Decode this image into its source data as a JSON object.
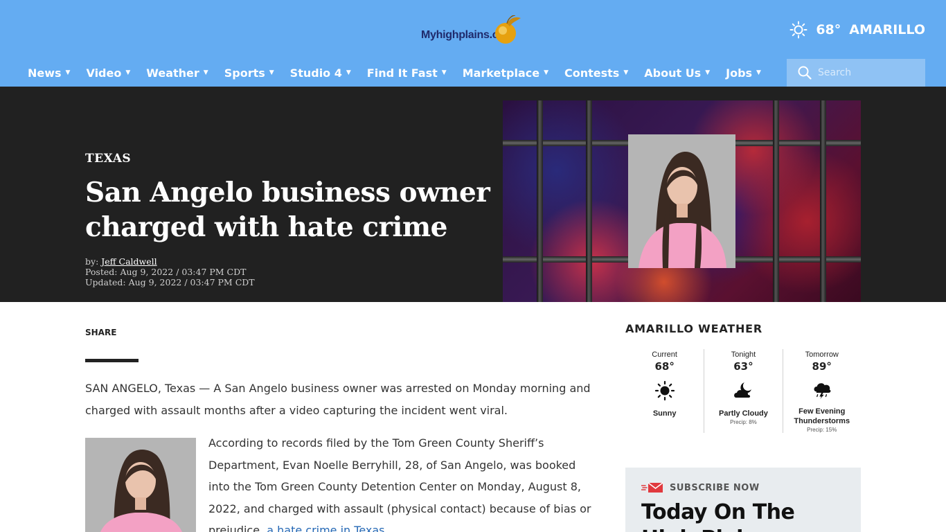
{
  "header": {
    "logo_text": "Myhighplains.com",
    "weather": {
      "temp": "68°",
      "city": "AMARILLO",
      "icon": "sun-icon"
    },
    "nav": [
      {
        "label": "News"
      },
      {
        "label": "Video"
      },
      {
        "label": "Weather"
      },
      {
        "label": "Sports"
      },
      {
        "label": "Studio 4"
      },
      {
        "label": "Find It Fast"
      },
      {
        "label": "Marketplace"
      },
      {
        "label": "Contests"
      },
      {
        "label": "About Us"
      },
      {
        "label": "Jobs"
      }
    ],
    "search_placeholder": "Search"
  },
  "article": {
    "kicker": "TEXAS",
    "headline": "San Angelo business owner charged with hate crime",
    "by_prefix": "by:",
    "author": "Jeff Caldwell",
    "posted": "Posted: Aug 9, 2022 / 03:47 PM CDT",
    "updated": "Updated: Aug 9, 2022 / 03:47 PM CDT",
    "share_label": "SHARE",
    "paragraph1": "SAN ANGELO, Texas — A San Angelo business owner was arrested on Monday morning and charged with assault months after a video capturing the incident went viral.",
    "paragraph2_text": "According to records filed by the Tom Green County Sheriff’s Department, Evan Noelle Berryhill, 28, of San Angelo, was booked into the Tom Green County Detention Center on Monday, August 8, 2022, and charged with assault (physical contact) because of bias or prejudice, ",
    "paragraph2_link": "a hate crime in Texas"
  },
  "sidebar": {
    "weather_title": "AMARILLO WEATHER",
    "forecast": [
      {
        "label": "Current",
        "temp": "68°",
        "icon": "sun-icon",
        "condition": "Sunny",
        "precip": ""
      },
      {
        "label": "Tonight",
        "temp": "63°",
        "icon": "moon-cloud-icon",
        "condition": "Partly Cloudy",
        "precip": "Precip: 8%"
      },
      {
        "label": "Tomorrow",
        "temp": "89°",
        "icon": "thunderstorm-icon",
        "condition": "Few Evening Thunderstorms",
        "precip": "Precip: 15%"
      }
    ],
    "subscribe_label": "SUBSCRIBE NOW",
    "newsletter_title": "Today On The High Plains"
  },
  "colors": {
    "header_bg": "#64acf2",
    "hero_bg": "#212121",
    "link": "#2568b5",
    "subscribe_bg": "#e8ecef"
  }
}
